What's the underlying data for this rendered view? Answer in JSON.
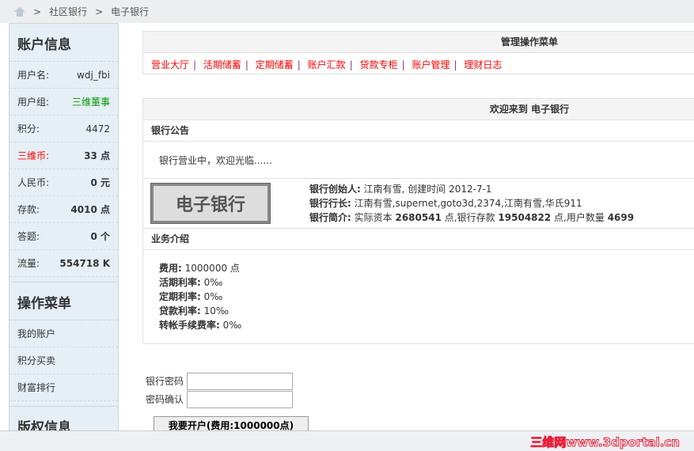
{
  "breadcrumb": [
    "社区银行",
    "电子银行"
  ],
  "sidebar": {
    "account_title": "账户信息",
    "rows": [
      {
        "label": "用户名:",
        "value": "wdj_fbi"
      },
      {
        "label": "用户组:",
        "value": "三维董事"
      },
      {
        "label": "积分:",
        "value": "4472"
      },
      {
        "label": "三维币:",
        "value": "33 点"
      },
      {
        "label": "人民币:",
        "value": "0 元"
      },
      {
        "label": "存款:",
        "value": "4010 点"
      },
      {
        "label": "答题:",
        "value": "0 个"
      },
      {
        "label": "流量:",
        "value": "554718 K"
      }
    ],
    "menu_title": "操作菜单",
    "menu": [
      "我的账户",
      "积分买卖",
      "财富排行"
    ],
    "copyright_title": "版权信息"
  },
  "menu_box": {
    "title": "管理操作菜单",
    "items": [
      "营业大厅",
      "活期储蓄",
      "定期储蓄",
      "账户汇款",
      "贷款专柜",
      "账户管理",
      "理财日志"
    ]
  },
  "welcome": {
    "title": "欢迎来到 电子银行",
    "notice_title": "银行公告",
    "notice": "银行营业中，欢迎光临......",
    "logo_text": "电子银行",
    "founder_label": "银行创始人:",
    "founder": "江南有雪, 创建时间 2012-7-1",
    "president_label": "银行行长:",
    "president": "江南有雪,supernet,goto3d,2374,江南有雪,华氏911",
    "intro_label": "银行简介:",
    "intro_p1": "实际资本",
    "capital": "2680541",
    "intro_p2": "点,银行存款",
    "deposit": "19504822",
    "intro_p3": "点,用户数量",
    "users": "4699",
    "biz_title": "业务介绍",
    "biz": [
      {
        "label": "费用:",
        "value": "1000000 点"
      },
      {
        "label": "活期利率:",
        "value": "0‰"
      },
      {
        "label": "定期利率:",
        "value": "0‰"
      },
      {
        "label": "贷款利率:",
        "value": "10‰"
      },
      {
        "label": "转帐手续费率:",
        "value": "0‰"
      }
    ]
  },
  "form": {
    "password_label": "银行密码",
    "confirm_label": "密码确认",
    "submit": "我要开户(费用:1000000点)"
  },
  "watermark": "三维网www.3dportal.cn"
}
